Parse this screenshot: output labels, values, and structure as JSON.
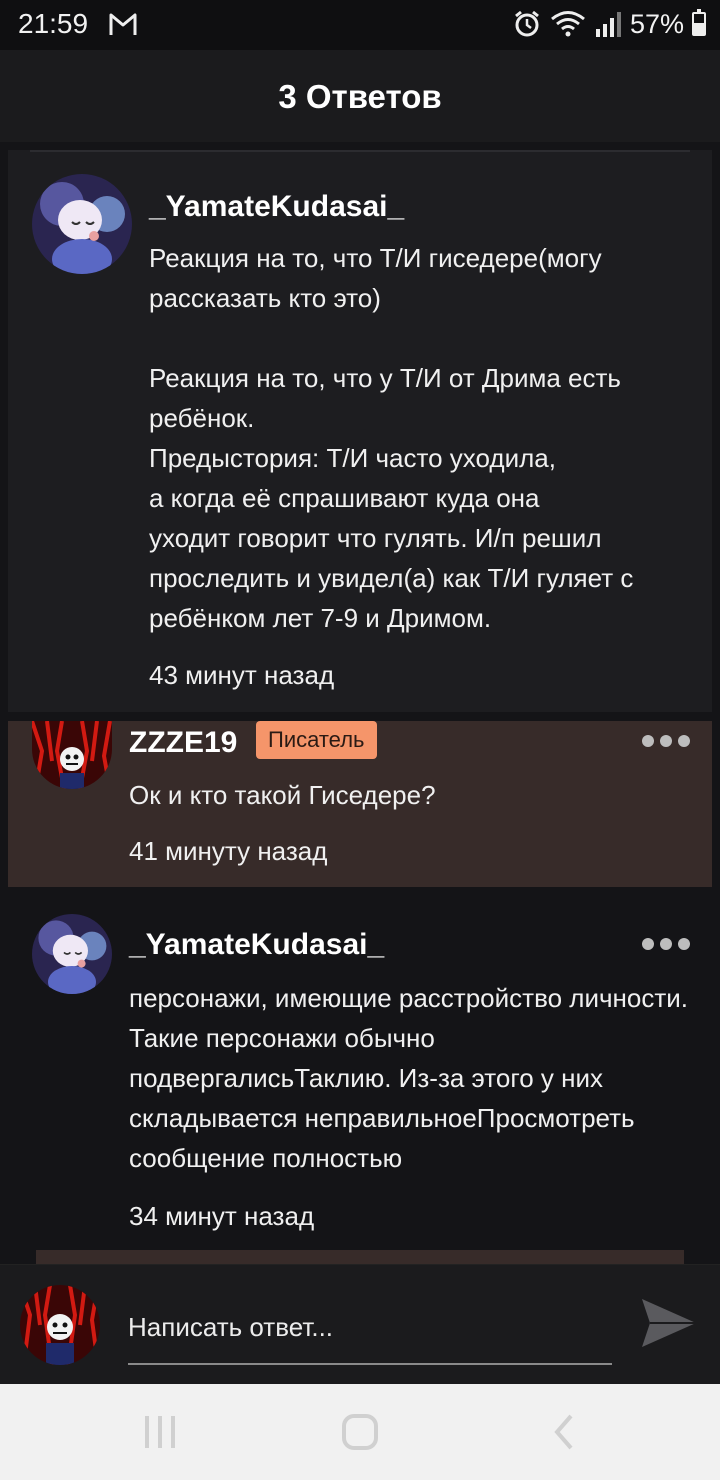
{
  "status_bar": {
    "time": "21:59",
    "battery": "57%",
    "battery_level": 0.57,
    "icons": [
      "gmail-icon",
      "alarm-icon",
      "wifi-icon",
      "signal-icon",
      "battery-icon"
    ]
  },
  "header": {
    "title": "3 Ответов"
  },
  "comments": [
    {
      "username": "_YamateKudasai_",
      "text": "Реакция на то, что Т/И гиседере(могу рассказать кто это)\n\nРеакция на то, что у Т/И от Дрима есть ребёнок.\nПредыстория: Т/И часто уходила,\nа когда её спрашивают куда она\nуходит говорит что гулять. И/п решил проследить и увидел(а) как Т/И гуляет с ребёнком лет 7-9 и Дримом.",
      "time": "43 минут назад"
    },
    {
      "username": "ZZZE19",
      "badge": "Писатель",
      "text": "Ок и кто такой Гиседере?",
      "time": "41 минуту назад"
    },
    {
      "username": "_YamateKudasai_",
      "text": "персонажи, имеющие расстройство личности. Такие персонажи обычно подвергалисьТаклию. Из-за этого у них складывается неправильноеПросмотреть сообщение полностью",
      "time": "34 минут назад"
    }
  ],
  "reply": {
    "placeholder": "Написать ответ..."
  },
  "colors": {
    "background": "#141417",
    "header": "#1b1b1d",
    "highlight_comment": "#372b29",
    "badge": "#f5956a",
    "nav_bar": "#f1f1f1"
  }
}
